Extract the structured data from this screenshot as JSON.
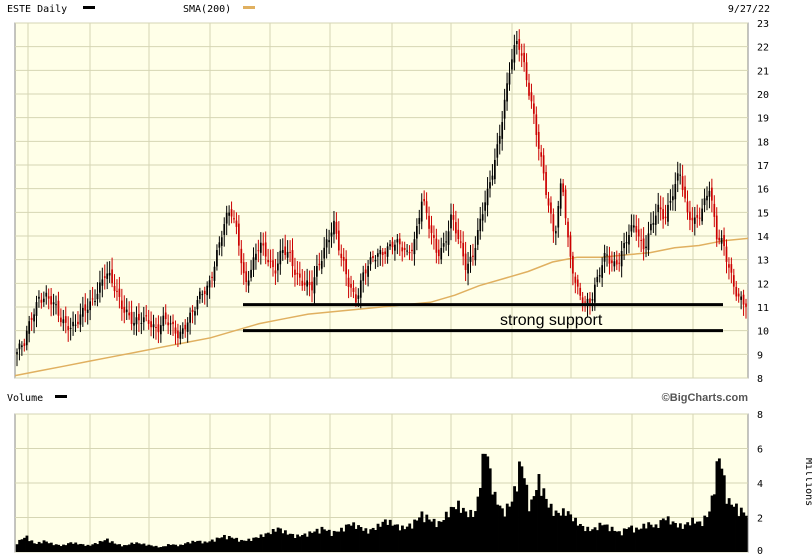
{
  "header": {
    "ticker_label": "ESTE Daily",
    "sma_label": "SMA(200)",
    "date": "9/27/22"
  },
  "volume_panel": {
    "label": "Volume",
    "watermark": "©BigCharts.com",
    "units_label": "Millions"
  },
  "colors": {
    "plot_background": "#ffffe8",
    "grid": "#d6d6b4",
    "candle_up": "#000000",
    "candle_down": "#cc0000",
    "sma_line": "#e0b060",
    "volume_fill": "#000000",
    "support_line": "#000000"
  },
  "chart_data": [
    {
      "type": "candlestick",
      "title": "ESTE Daily",
      "period": "daily, roughly Sep 2021 to 9/27/22",
      "y_ticks": [
        8,
        9,
        10,
        11,
        12,
        13,
        14,
        15,
        16,
        17,
        18,
        19,
        20,
        21,
        22,
        23
      ],
      "ylim": [
        8,
        23
      ],
      "grid": true,
      "series": [
        {
          "name": "ESTE Daily",
          "kind": "price",
          "approx_close_path": [
            9.1,
            9.3,
            10.6,
            11.6,
            11.4,
            10.9,
            10.5,
            10.4,
            10.2,
            10.6,
            11.2,
            11.9,
            12.4,
            11.8,
            11.3,
            10.9,
            10.2,
            10.3,
            10.5,
            10.2,
            10.4,
            10.0,
            9.9,
            10.5,
            10.7,
            11.4,
            12.0,
            13.2,
            14.2,
            15.0,
            14.2,
            12.0,
            12.6,
            13.6,
            13.3,
            12.6,
            13.2,
            13.1,
            12.5,
            12.1,
            11.6,
            12.7,
            13.9,
            14.6,
            12.9,
            12.0,
            11.5,
            12.4,
            12.7,
            13.2,
            13.6,
            13.7,
            13.4,
            13.2,
            14.0,
            15.6,
            14.2,
            13.3,
            13.8,
            14.8,
            13.6,
            12.7,
            13.5,
            14.7,
            15.7,
            17.4,
            19.4,
            21.2,
            22.1,
            21.1,
            19.6,
            17.4,
            15.4,
            14.1,
            16.7,
            13.1,
            11.6,
            11.3,
            11.5,
            12.2,
            13.1,
            12.9,
            13.3,
            13.9,
            14.3,
            13.6,
            14.4,
            15.0,
            14.6,
            16.0,
            16.9,
            14.7,
            14.5,
            15.3,
            16.2,
            13.8,
            13.5,
            12.5,
            11.4,
            10.9
          ]
        },
        {
          "name": "SMA(200)",
          "kind": "moving_average",
          "approx_path": [
            8.1,
            8.3,
            8.5,
            8.7,
            8.9,
            9.1,
            9.3,
            9.5,
            9.7,
            10.0,
            10.3,
            10.5,
            10.7,
            10.8,
            10.9,
            11.0,
            11.1,
            11.2,
            11.5,
            11.9,
            12.2,
            12.5,
            12.9,
            13.1,
            13.1,
            13.2,
            13.3,
            13.5,
            13.6,
            13.8,
            13.9
          ]
        }
      ],
      "annotations": [
        {
          "type": "horizontal_line",
          "y": 11.1,
          "label": ""
        },
        {
          "type": "horizontal_line",
          "y": 10.0,
          "label": ""
        },
        {
          "type": "text",
          "text": "strong support",
          "y": 10.5
        }
      ]
    },
    {
      "type": "bar",
      "title": "Volume",
      "y_ticks": [
        0,
        2,
        4,
        6,
        8
      ],
      "ylim": [
        0,
        8
      ],
      "ylabel": "Millions",
      "series": [
        {
          "name": "Volume",
          "approx_values_millions": [
            0.6,
            1.0,
            0.5,
            0.7,
            0.5,
            0.4,
            0.6,
            0.5,
            0.4,
            0.6,
            0.8,
            0.5,
            0.4,
            0.6,
            0.5,
            0.4,
            0.3,
            0.5,
            0.4,
            0.6,
            0.7,
            0.6,
            0.8,
            1.0,
            0.9,
            0.7,
            0.8,
            1.0,
            1.2,
            1.5,
            1.2,
            1.0,
            1.1,
            1.3,
            1.5,
            1.2,
            1.4,
            1.8,
            1.6,
            1.3,
            1.6,
            2.0,
            1.7,
            1.5,
            1.8,
            2.4,
            2.0,
            1.8,
            2.6,
            3.0,
            2.4,
            2.5,
            6.8,
            3.6,
            2.5,
            3.2,
            5.8,
            2.8,
            4.6,
            3.0,
            2.4,
            2.6,
            2.0,
            1.5,
            1.4,
            1.8,
            1.5,
            1.2,
            1.6,
            1.4,
            1.8,
            1.6,
            2.2,
            1.8,
            1.6,
            2.0,
            1.8,
            2.6,
            6.2,
            3.2,
            2.8,
            2.4
          ]
        }
      ]
    }
  ]
}
